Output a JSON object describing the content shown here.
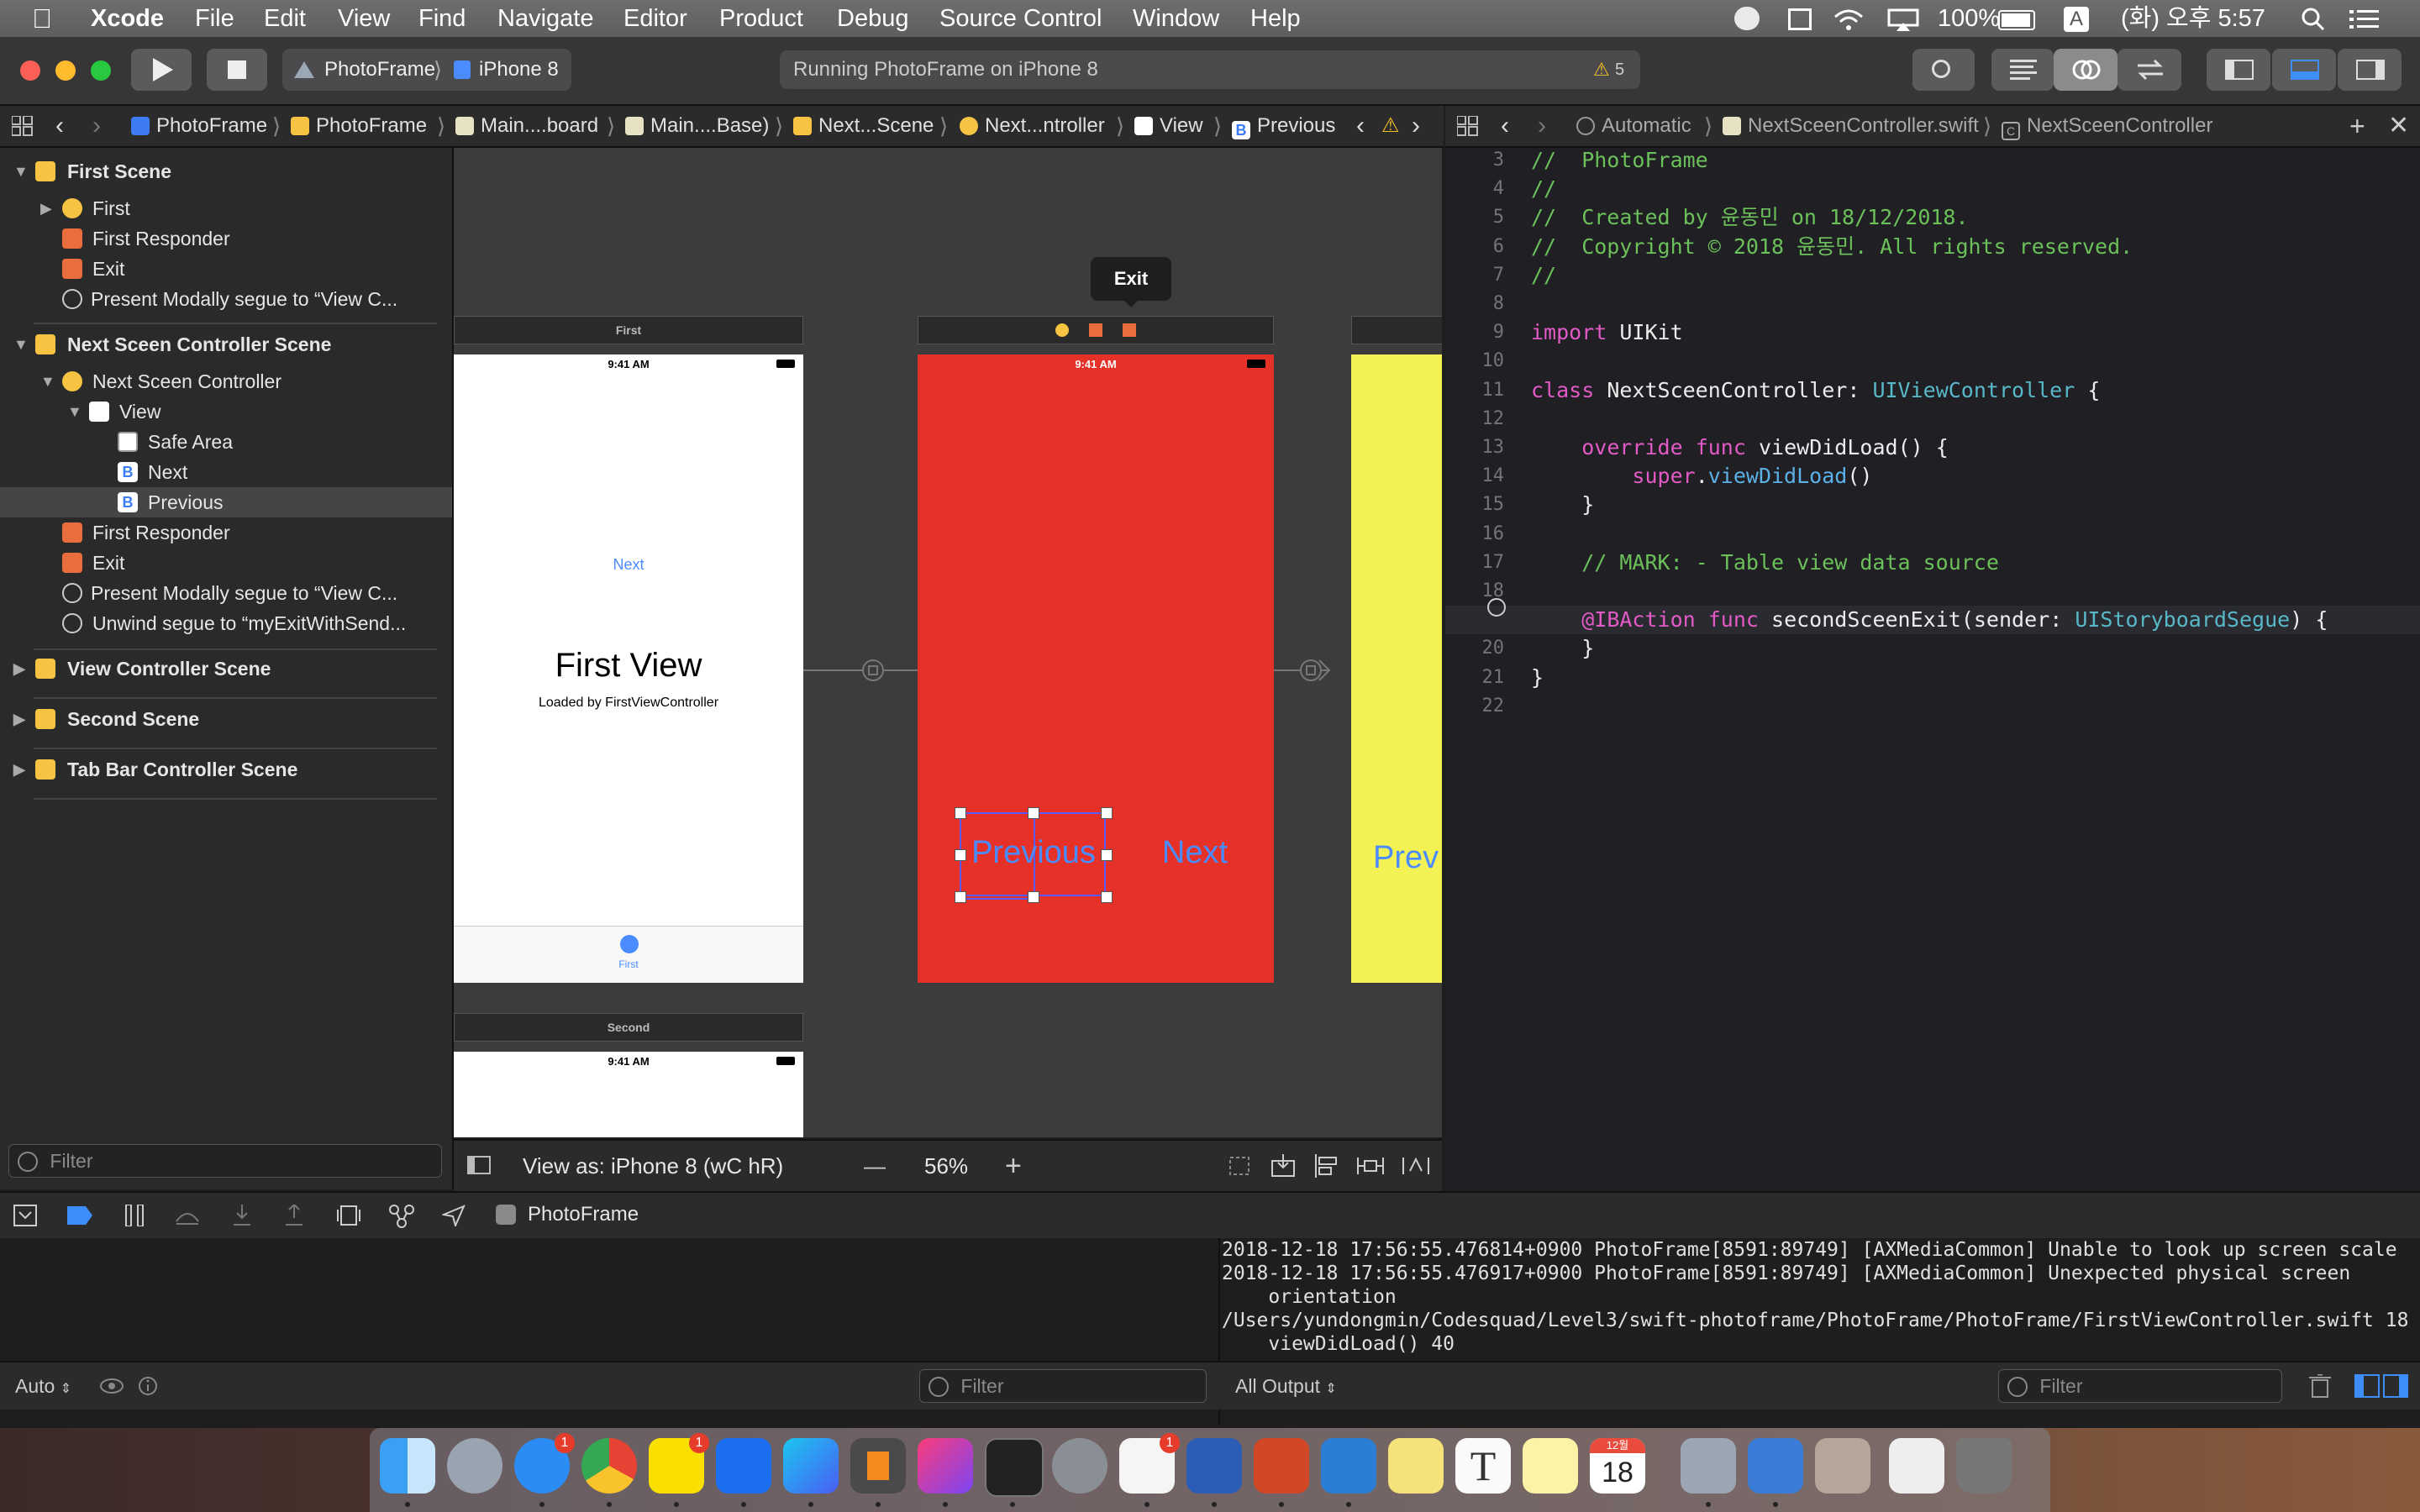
{
  "menubar": {
    "app": "Xcode",
    "items": [
      "File",
      "Edit",
      "View",
      "Find",
      "Navigate",
      "Editor",
      "Product",
      "Debug",
      "Source Control",
      "Window",
      "Help"
    ],
    "battery": "100%",
    "input": "A",
    "clock": "(화) 오후 5:57"
  },
  "toolbar": {
    "scheme": "PhotoFrame",
    "device": "iPhone 8",
    "status": "Running PhotoFrame on iPhone 8",
    "warnings": "5"
  },
  "jumpbar": {
    "crumbs": [
      "PhotoFrame",
      "PhotoFrame",
      "Main....board",
      "Main....Base)",
      "Next...Scene",
      "Next...ntroller",
      "View",
      "Previous"
    ]
  },
  "jumpbar2": {
    "crumbs": [
      "Automatic",
      "NextSceenController.swift",
      "NextSceenController"
    ]
  },
  "outline": {
    "items": [
      "First Scene",
      "First",
      "First Responder",
      "Exit",
      "Present Modally segue to “View C...",
      "Next Sceen Controller Scene",
      "Next Sceen Controller",
      "View",
      "Safe Area",
      "Next",
      "Previous",
      "First Responder",
      "Exit",
      "Present Modally segue to “View C...",
      "Unwind segue to “myExitWithSend...",
      "View Controller Scene",
      "Second Scene",
      "Tab Bar Controller Scene"
    ],
    "filter_placeholder": "Filter"
  },
  "canvas": {
    "first_header": "First",
    "time": "9:41 AM",
    "first_next": "Next",
    "first_view_title": "First View",
    "first_view_subtitle": "Loaded by FirstViewController",
    "tab_first": "First",
    "second_header": "Second",
    "exit_popup": "Exit",
    "prev_button": "Previous",
    "next_button": "Next",
    "third_button": "Prev"
  },
  "canvasbar": {
    "view_as": "View as: iPhone 8 (wC hR)",
    "zoom": "56%",
    "minus": "—",
    "plus": "+"
  },
  "code": {
    "lines": [
      {
        "n": "3",
        "t": "//  PhotoFrame"
      },
      {
        "n": "4",
        "t": "//"
      },
      {
        "n": "5",
        "t": "//  Created by 윤동민 on 18/12/2018."
      },
      {
        "n": "6",
        "t": "//  Copyright © 2018 윤동민. All rights reserved."
      },
      {
        "n": "7",
        "t": "//"
      },
      {
        "n": "8",
        "t": ""
      },
      {
        "n": "9",
        "t": "import UIKit"
      },
      {
        "n": "10",
        "t": ""
      },
      {
        "n": "11",
        "t": "class NextSceenController: UIViewController {"
      },
      {
        "n": "12",
        "t": ""
      },
      {
        "n": "13",
        "t": "    override func viewDidLoad() {"
      },
      {
        "n": "14",
        "t": "        super.viewDidLoad()"
      },
      {
        "n": "15",
        "t": "    }"
      },
      {
        "n": "16",
        "t": ""
      },
      {
        "n": "17",
        "t": "    // MARK: - Table view data source"
      },
      {
        "n": "18",
        "t": ""
      },
      {
        "n": "19",
        "t": "    @IBAction func secondSceenExit(sender: UIStoryboardSegue) {"
      },
      {
        "n": "20",
        "t": "    }"
      },
      {
        "n": "21",
        "t": "}"
      },
      {
        "n": "22",
        "t": ""
      }
    ]
  },
  "debugbar": {
    "target": "PhotoFrame"
  },
  "console": {
    "lines": [
      "2018-12-18 17:56:55.476814+0900 PhotoFrame[8591:89749] [AXMediaCommon] Unable to look up screen scale",
      "2018-12-18 17:56:55.476917+0900 PhotoFrame[8591:89749] [AXMediaCommon] Unexpected physical screen",
      "    orientation",
      "/Users/yundongmin/Codesquad/Level3/swift-photoframe/PhotoFrame/PhotoFrame/FirstViewController.swift 18",
      "    viewDidLoad() 40"
    ]
  },
  "bottombar": {
    "auto": "Auto",
    "filter1": "Filter",
    "all_output": "All Output",
    "filter2": "Filter"
  },
  "dock": {
    "badge_appstore": "1",
    "badge_talk": "1",
    "badge_s": "1",
    "calendar_month": "12월",
    "calendar_day": "18"
  },
  "colors": {
    "red_scene": "#e53127",
    "yellow_scene": "#f3f255",
    "ios_blue": "#4a8cff"
  }
}
